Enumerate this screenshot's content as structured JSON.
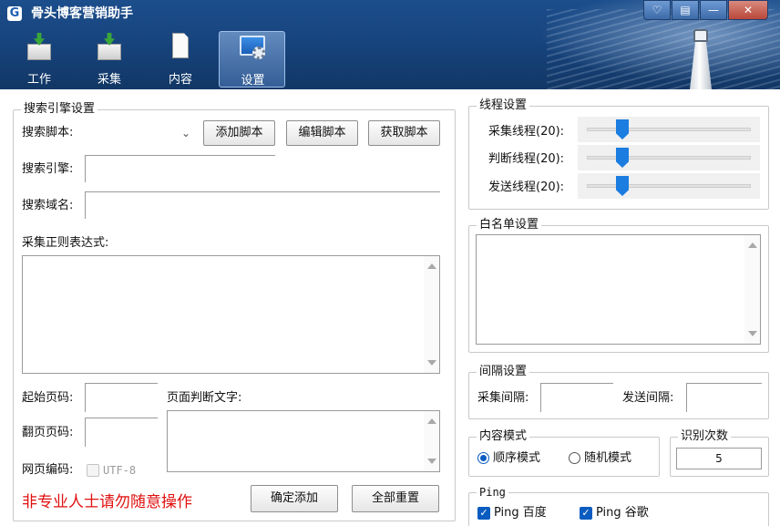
{
  "window": {
    "app_icon": "G",
    "title": "骨头博客营销助手",
    "controls": [
      "skin-icon",
      "menu-icon",
      "minimize-icon",
      "close-icon"
    ]
  },
  "toolbar": {
    "work": "工作",
    "collect": "采集",
    "content": "内容",
    "settings": "设置",
    "active": "settings"
  },
  "search_engine": {
    "title": "搜索引擎设置",
    "script_label": "搜索脚本:",
    "script_value": "",
    "add_script": "添加脚本",
    "edit_script": "编辑脚本",
    "get_script": "获取脚本",
    "engine_label": "搜索引擎:",
    "engine_value": "",
    "domain_label": "搜索域名:",
    "domain_value": "",
    "regex_label": "采集正则表达式:",
    "regex_value": "",
    "start_page_label": "起始页码:",
    "start_page_value": "",
    "page_turn_label": "翻页页码:",
    "page_turn_value": "",
    "page_judge_label": "页面判断文字:",
    "page_judge_value": "",
    "encoding_label": "网页编码:",
    "encoding_checkbox": "UTF-8",
    "encoding_checked": false,
    "warning": "非专业人士请勿随意操作",
    "confirm_add": "确定添加",
    "reset_all": "全部重置"
  },
  "threads": {
    "title": "线程设置",
    "collect_label": "采集线程(20):",
    "collect_value": 20,
    "judge_label": "判断线程(20):",
    "judge_value": 20,
    "send_label": "发送线程(20):",
    "send_value": 20
  },
  "whitelist": {
    "title": "白名单设置",
    "value": ""
  },
  "interval": {
    "title": "间隔设置",
    "collect_label": "采集间隔:",
    "collect_value": "",
    "send_label": "发送间隔:",
    "send_value": ""
  },
  "content_mode": {
    "title": "内容模式",
    "sequential": "顺序模式",
    "random": "随机模式",
    "selected": "sequential"
  },
  "recognize": {
    "title": "识别次数",
    "value": "5"
  },
  "ping": {
    "title": "Ping",
    "baidu": "Ping 百度",
    "baidu_checked": true,
    "google": "Ping 谷歌",
    "google_checked": true
  },
  "colors": {
    "header": "#16427a",
    "accent": "#0b5cc0",
    "slider": "#1b7de0",
    "warning": "#e01010"
  }
}
